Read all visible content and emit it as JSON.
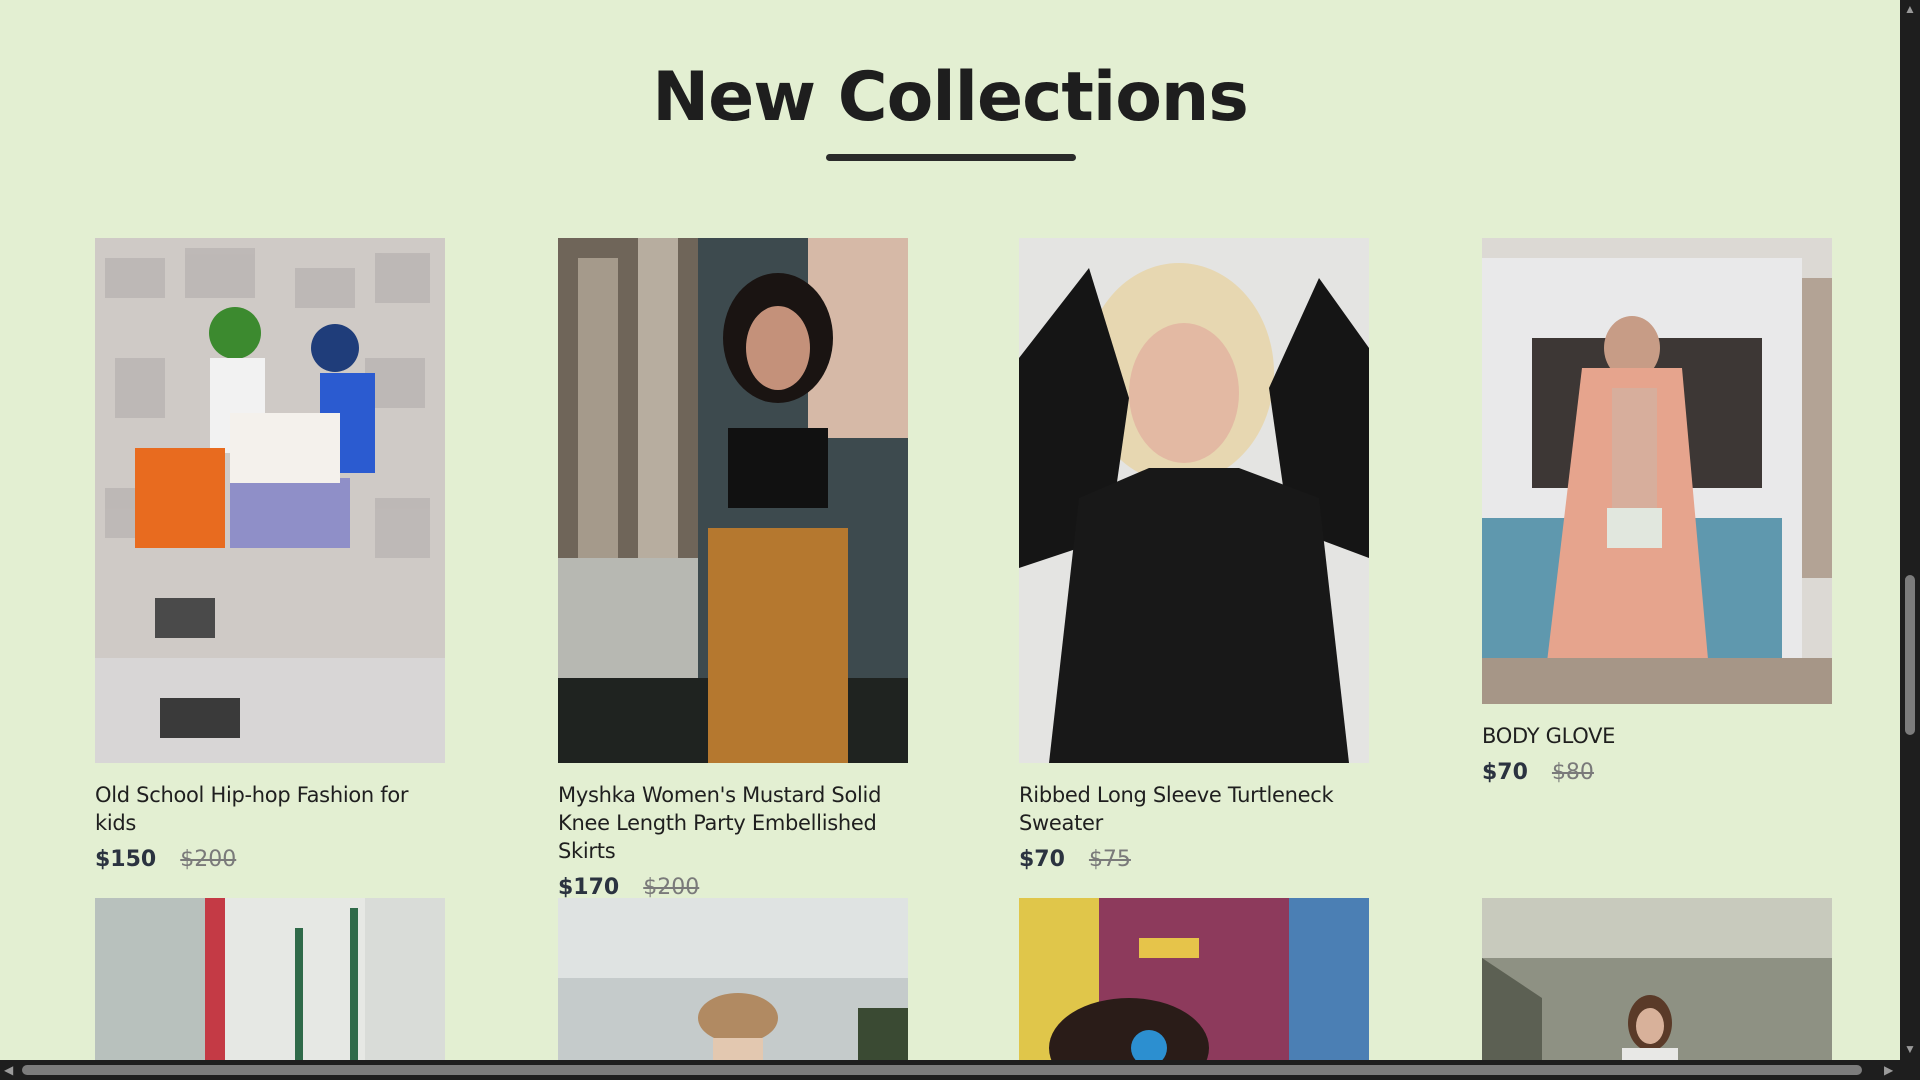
{
  "section": {
    "title": "New Collections"
  },
  "products": [
    {
      "name": "Old School Hip-hop Fashion for kids",
      "price": "$150",
      "old_price": "$200"
    },
    {
      "name": "Myshka Women's Mustard Solid Knee Length Party Embellished Skirts",
      "price": "$170",
      "old_price": "$200"
    },
    {
      "name": "Ribbed Long Sleeve Turtleneck Sweater",
      "price": "$70",
      "old_price": "$75"
    },
    {
      "name": "BODY GLOVE",
      "price": "$70",
      "old_price": "$80"
    }
  ],
  "icons": {
    "scroll_up": "scroll-up-arrow-icon",
    "scroll_down": "scroll-down-arrow-icon",
    "scroll_left": "scroll-left-arrow-icon",
    "scroll_right": "scroll-right-arrow-icon"
  },
  "colors": {
    "background": "#e3efd2",
    "title": "#1e1e1e",
    "price": "#2b3340",
    "old_price": "#7a7a7a"
  }
}
